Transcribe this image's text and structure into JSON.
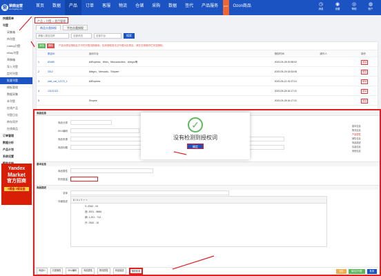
{
  "app": {
    "logo_line1": "荣鼎运营",
    "logo_line2": "erp.rongding.com"
  },
  "nav": [
    "首页",
    "数据",
    "产品",
    "订单",
    "客服",
    "物流",
    "仓储",
    "采购",
    "数据",
    "签代",
    "产品服务",
    "Ozon商品"
  ],
  "nav_hot": "HOT",
  "nav_right": [
    {
      "icon": "◷",
      "label": "消息"
    },
    {
      "icon": "◉",
      "label": "设置"
    },
    {
      "icon": "◎",
      "label": "帮助"
    },
    {
      "icon": "◍",
      "label": "账户"
    }
  ],
  "sidebar": [
    "快捷菜单",
    "刊登",
    "采集箱",
    "待刊登",
    "Listing刊登",
    "eBay刊登",
    "草稿箱",
    "导入刊登",
    "定时刊登",
    "批量刊登",
    "模板管理",
    "数据采集",
    "未刊登",
    "在线产品",
    "刊登日志",
    "库存同步",
    "在线商品",
    "订单管理",
    "数据分析",
    "产品计划",
    "系统设置",
    "帮助文档"
  ],
  "sidebar_ad": {
    "l1": "Yandex",
    "l2": "Market",
    "l3": "官方招商",
    "l4": "0佣金 0保证金"
  },
  "breadcrumb": "产品 > 刊登 > 类目管理",
  "tabs": [
    "商品分类授权",
    "平台分类授权"
  ],
  "filters": {
    "f1": "请输入类目名称",
    "f2": "全部状态",
    "f3": "全部平台",
    "search": "搜索"
  },
  "toolbar": {
    "add": "添加",
    "del": "删除",
    "tip": "产品对类目授权后方可在刊登流程使用；如未授权将无法刊登对应类目，请在右侧操作栏完成授权。"
  },
  "table": {
    "headers": [
      "",
      "类目ID",
      "适用平台",
      "授权时间",
      "操作人",
      "操作"
    ],
    "rows": [
      [
        "1",
        "83485",
        "AliExpress、Wish、MercadoLibre、Allegro等",
        "2020-05-28 20:58:02",
        "",
        "删除"
      ],
      [
        "2",
        "3312",
        "Allegro、Mercado、Shopee",
        "2020-05-29 15:53:06",
        "",
        "删除"
      ],
      [
        "3",
        "cbid_cat_12170_1",
        "AliExpress",
        "2020-05-22 15:37:01",
        "",
        "删除"
      ],
      [
        "4",
        "13121321",
        "",
        "2020-05-28 16:17:31",
        "",
        "删除"
      ],
      [
        "5",
        "",
        "Shopee",
        "2020-05-28 16:17:31",
        "",
        "删除"
      ]
    ]
  },
  "modal": {
    "title": "商品信息",
    "labels": [
      "商品分类",
      "SKU编码",
      "商品来源",
      "商品标题",
      "商品图片",
      "商品属性",
      "物流重量",
      "变体",
      "详细描述",
      "包装信息"
    ],
    "sections": [
      "基本信息",
      "物流信息",
      "商品描述"
    ],
    "rtnav": [
      "基本信息",
      "物流信息",
      "产品属性",
      "销售信息",
      "商品描述",
      "包装信息",
      "其他信息"
    ],
    "editor_lines": [
      "V: 2342 - 10",
      "品: 2021 - 5684",
      "销: 1,201 - 712",
      "尺: 2342 - 10"
    ],
    "bottom": [
      "商品ID",
      "分类授权",
      "SKU编码",
      "商品属性",
      "物流属性",
      "商品描述",
      "授权检测"
    ],
    "save": "保存",
    "publish": "保存并刊登",
    "cancel": "取消"
  },
  "dialog": {
    "message": "没有检测到授权词",
    "ok": "确定"
  }
}
